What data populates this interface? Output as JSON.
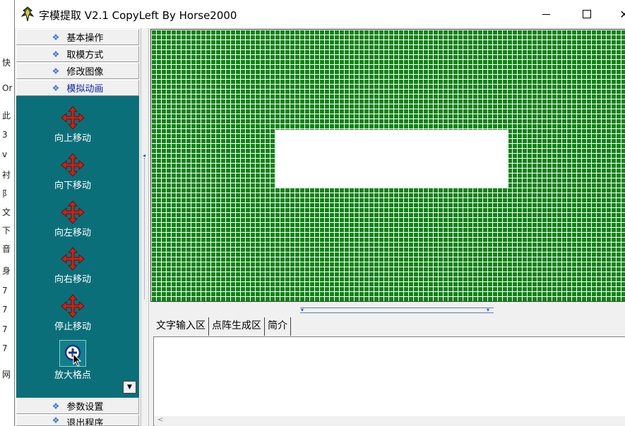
{
  "background_window": {
    "items": [
      "快",
      "Or",
      "此",
      "3",
      "v",
      "衬",
      "阝",
      "文",
      "下",
      "音",
      "身",
      "7",
      "7",
      "7",
      "7",
      "网"
    ]
  },
  "window": {
    "title": "字模提取 V2.1  CopyLeft By Horse2000",
    "minimize_icon": "minimize-icon",
    "maximize_icon": "maximize-icon",
    "close_icon": "close-icon",
    "close_glyph": "✕"
  },
  "left_panel": {
    "menus": [
      {
        "label": "基本操作",
        "icon": "diamond-icon",
        "glyph": "❖"
      },
      {
        "label": "取模方式",
        "icon": "diamond-icon",
        "glyph": "❖"
      },
      {
        "label": "修改图像",
        "icon": "diamond-icon",
        "glyph": "❖"
      },
      {
        "label": "模拟动画",
        "icon": "diamond-icon",
        "glyph": "❖"
      }
    ],
    "animation_items": [
      {
        "label": "向上移动",
        "icon": "move-arrows-icon"
      },
      {
        "label": "向下移动",
        "icon": "move-arrows-icon"
      },
      {
        "label": "向左移动",
        "icon": "move-arrows-icon"
      },
      {
        "label": "向右移动",
        "icon": "move-arrows-icon"
      },
      {
        "label": "停止移动",
        "icon": "move-arrows-icon"
      },
      {
        "label": "放大格点",
        "icon": "zoom-in-icon"
      }
    ],
    "scroll_down_glyph": "▼",
    "bottom_menus": [
      {
        "label": "参数设置",
        "glyph": "❖"
      },
      {
        "label": "退出程序",
        "glyph": "❖"
      }
    ]
  },
  "canvas": {
    "grid_color": "#0f8316",
    "grid_line_color": "#ffffff",
    "panel_color": "#0b6f79"
  },
  "tabs": [
    {
      "label": "文字输入区",
      "active": true
    },
    {
      "label": "点阵生成区",
      "active": false
    },
    {
      "label": "简介",
      "active": false
    }
  ],
  "splitter_glyphs": {
    "left": "◂",
    "down": "▾",
    "right": "▾"
  }
}
